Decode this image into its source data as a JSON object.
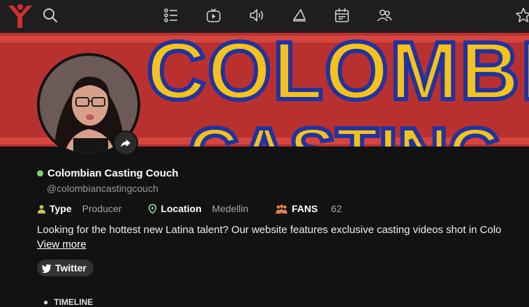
{
  "nav": {
    "icons": [
      "logo-icon",
      "search-icon",
      "list-icon",
      "video-icon",
      "sound-icon",
      "megaphone-icon",
      "calendar-icon",
      "people-icon",
      "star-icon"
    ]
  },
  "profile": {
    "name": "Colombian Casting Couch",
    "handle": "@colombiancastingcouch",
    "online": true,
    "banner_line1": "COLOMBIA",
    "banner_line2": "CASTING",
    "type_label": "Type",
    "type_value": "Producer",
    "location_label": "Location",
    "location_value": "Medellin",
    "fans_label": "FANS",
    "fans_value": "62",
    "bio": "Looking for the hottest new Latina talent? Our website features exclusive casting videos shot in Colo",
    "view_more": "View more",
    "twitter_label": "Twitter",
    "timeline_label": "TIMELINE"
  },
  "colors": {
    "accent_red": "#d32f2f",
    "banner_red": "#b8312f",
    "banner_yellow": "#f4c21c",
    "banner_blue": "#2233a0",
    "online_green": "#7fd36a",
    "icon_yellow": "#c9c05a",
    "pin_green": "#8fd0a8",
    "fans_orange": "#e8804a"
  }
}
